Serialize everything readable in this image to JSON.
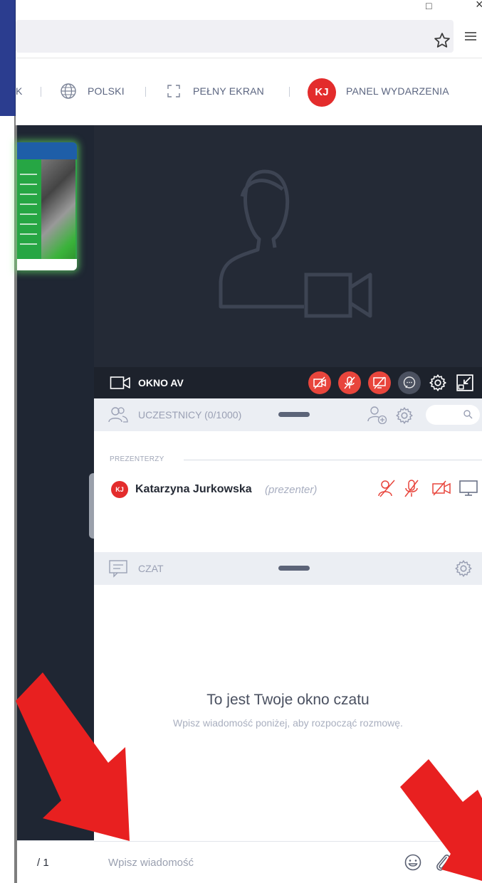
{
  "header": {
    "partial_left_label": "K",
    "language_label": "POLSKI",
    "fullscreen_label": "PEŁNY EKRAN",
    "user_initials": "KJ",
    "event_panel_label": "PANEL WYDARZENIA"
  },
  "presentation": {
    "page_indicator": "/ 1"
  },
  "av_window": {
    "title": "OKNO AV"
  },
  "participants": {
    "title": "UCZESTNICY (0/1000)",
    "presenters_label": "PREZENTERZY",
    "presenter": {
      "initials": "KJ",
      "name": "Katarzyna Jurkowska",
      "role": "(prezenter)"
    }
  },
  "chat": {
    "title": "CZAT",
    "empty_title": "To jest Twoje okno czatu",
    "empty_subtitle": "Wpisz wiadomość poniżej, aby rozpocząć rozmowę.",
    "input_placeholder": "Wpisz wiadomość"
  },
  "colors": {
    "accent_red": "#e32c2c",
    "send_green": "#59c76b",
    "dark_panel": "#242a36",
    "side_blue": "#2b3d8f"
  },
  "icons": [
    "star-icon",
    "menu-icon",
    "globe-icon",
    "fullscreen-icon",
    "camera-icon",
    "video-off-icon",
    "mic-off-icon",
    "screen-share-off-icon",
    "chat-bubble-icon",
    "gear-icon",
    "minimize-window-icon",
    "people-icon",
    "add-user-icon",
    "search-icon",
    "presenter-icon",
    "emoji-icon",
    "attach-icon",
    "send-icon",
    "person-placeholder-icon"
  ]
}
